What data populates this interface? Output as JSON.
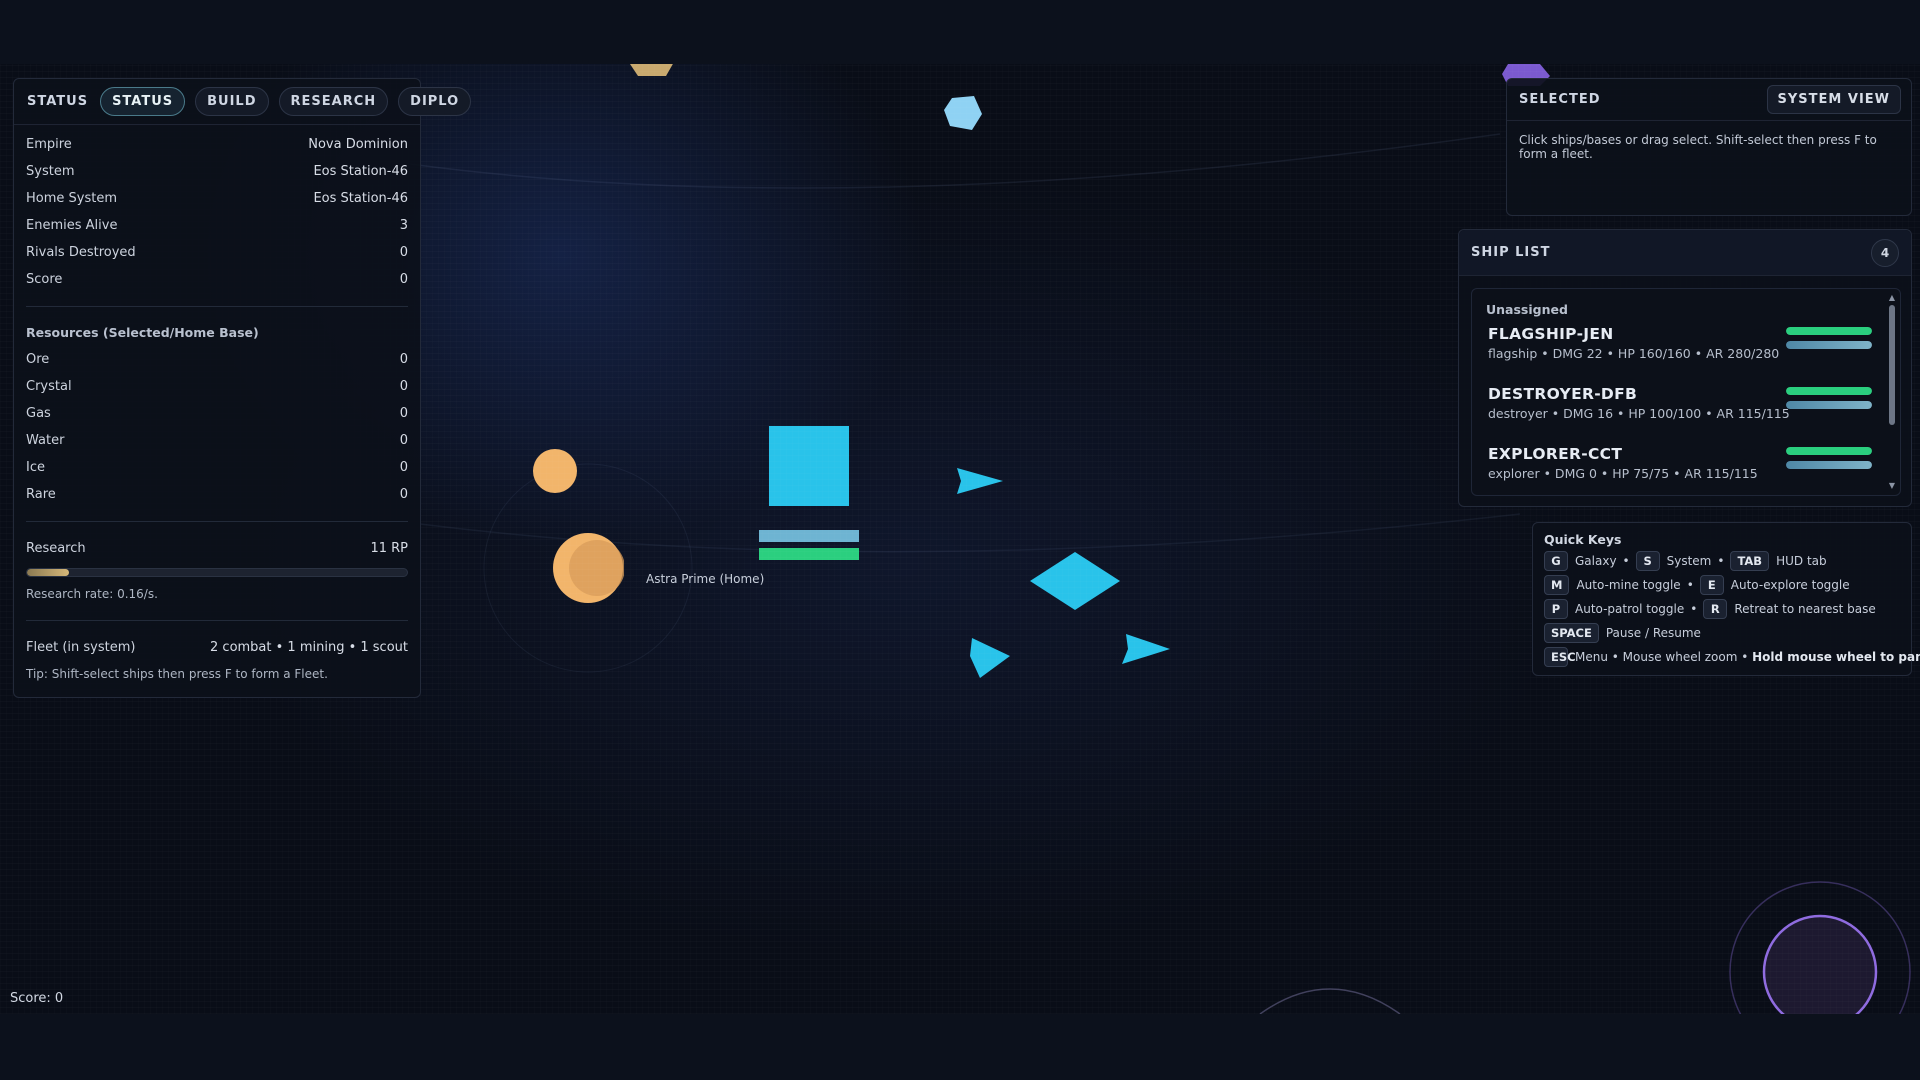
{
  "hud": {
    "tabs": [
      "STATUS",
      "STATUS",
      "BUILD",
      "RESEARCH",
      "DIPLO"
    ],
    "status": [
      {
        "key": "Empire",
        "value": "Nova Dominion"
      },
      {
        "key": "System",
        "value": "Eos Station-46"
      },
      {
        "key": "Home System",
        "value": "Eos Station-46"
      },
      {
        "key": "Enemies Alive",
        "value": "3"
      },
      {
        "key": "Rivals Destroyed",
        "value": "0"
      },
      {
        "key": "Score",
        "value": "0"
      }
    ],
    "resources_title": "Resources (Selected/Home Base)",
    "resources": [
      {
        "key": "Ore",
        "value": "0"
      },
      {
        "key": "Crystal",
        "value": "0"
      },
      {
        "key": "Gas",
        "value": "0"
      },
      {
        "key": "Water",
        "value": "0"
      },
      {
        "key": "Ice",
        "value": "0"
      },
      {
        "key": "Rare",
        "value": "0"
      }
    ],
    "research": {
      "label": "Research",
      "value": "11 RP",
      "progress": 0.11,
      "rate": "Research rate: 0.16/s."
    },
    "fleet": {
      "label": "Fleet (in system)",
      "value": "2 combat • 1 mining • 1 scout"
    },
    "tip": "Tip: Shift-select ships then press F to form a Fleet."
  },
  "selected": {
    "title": "SELECTED",
    "button": "SYSTEM VIEW",
    "hint": "Click ships/bases or drag select. Shift-select then press F to form a fleet."
  },
  "shiplist": {
    "title": "SHIP LIST",
    "count": "4",
    "group": "Unassigned",
    "ships": [
      {
        "name": "FLAGSHIP-JEN",
        "desc": "flagship • DMG 22 • HP 160/160 • AR 280/280",
        "hp": 1.0,
        "ar": 1.0
      },
      {
        "name": "DESTROYER-DFB",
        "desc": "destroyer • DMG 16 • HP 100/100 • AR 115/115",
        "hp": 1.0,
        "ar": 1.0
      },
      {
        "name": "EXPLORER-CCT",
        "desc": "explorer • DMG 0 • HP 75/75 • AR 115/115",
        "hp": 1.0,
        "ar": 1.0
      }
    ]
  },
  "quickkeys": {
    "title": "Quick Keys",
    "rows": [
      [
        {
          "key": "G",
          "label": "Galaxy"
        },
        {
          "key": "S",
          "label": "System"
        },
        {
          "key": "TAB",
          "label": "HUD tab"
        }
      ],
      [
        {
          "key": "M",
          "label": "Auto-mine toggle"
        },
        {
          "key": "E",
          "label": "Auto-explore toggle"
        }
      ],
      [
        {
          "key": "P",
          "label": "Auto-patrol toggle"
        },
        {
          "key": "R",
          "label": "Retreat to nearest base"
        }
      ],
      [
        {
          "key": "SPACE",
          "label": "Pause / Resume"
        }
      ],
      [
        {
          "key": "ESC",
          "label": "Menu • Mouse wheel zoom •"
        }
      ]
    ],
    "last_bold": "Hold mouse wheel to pan"
  },
  "map": {
    "planet_label": "Astra Prime (Home)"
  },
  "footer": {
    "score": "Score: 0"
  },
  "colors": {
    "ship": "#29c3ea",
    "planet": "#f2b56b",
    "hp": "#2bcf7f",
    "accent": "#7f5cd6"
  }
}
